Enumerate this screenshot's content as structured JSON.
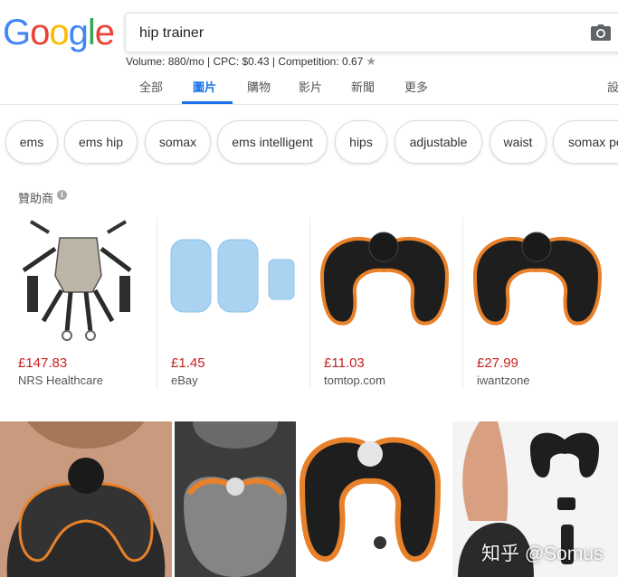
{
  "logo": {
    "text": "Google"
  },
  "search": {
    "value": "hip trainer"
  },
  "seo": {
    "text": "Volume: 880/mo | CPC: $0.43 | Competition: 0.67"
  },
  "tabs": [
    {
      "label": "全部",
      "active": false
    },
    {
      "label": "圖片",
      "active": true
    },
    {
      "label": "購物",
      "active": false
    },
    {
      "label": "影片",
      "active": false
    },
    {
      "label": "新聞",
      "active": false
    },
    {
      "label": "更多",
      "active": false
    }
  ],
  "settings_label": "設",
  "chips": [
    "ems",
    "ems hip",
    "somax",
    "ems intelligent",
    "hips",
    "adjustable",
    "waist",
    "somax po"
  ],
  "sponsor": {
    "label": "贊助商"
  },
  "products": [
    {
      "price": "£147.83",
      "store": "NRS Healthcare"
    },
    {
      "price": "£1.45",
      "store": "eBay"
    },
    {
      "price": "£11.03",
      "store": "tomtop.com"
    },
    {
      "price": "£27.99",
      "store": "iwantzone"
    }
  ],
  "watermark": "知乎 @Somus",
  "colors": {
    "accent": "#1a73e8",
    "price": "#c5221f",
    "trainer_orange": "#e8812a",
    "trainer_black": "#1e1e1e"
  }
}
